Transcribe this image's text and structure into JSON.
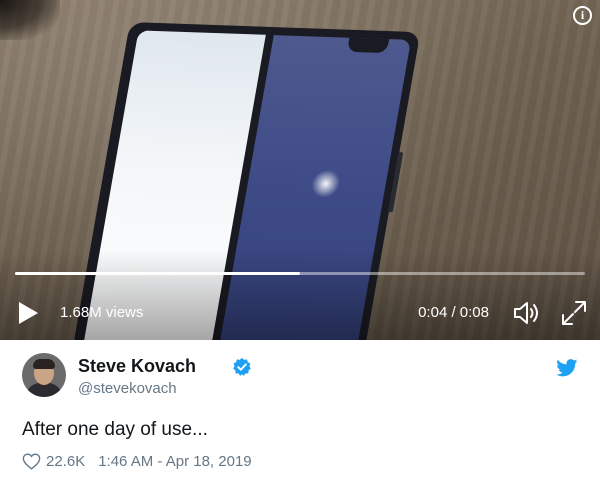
{
  "video": {
    "views": "1.68M views",
    "time": "0:04 / 0:08",
    "progress_fraction": 0.5,
    "info_symbol": "i",
    "icons": [
      "info-icon",
      "play-icon",
      "volume-icon",
      "fullscreen-icon"
    ]
  },
  "author": {
    "name": "Steve Kovach",
    "handle": "@stevekovach",
    "verified": true
  },
  "tweet": {
    "text": "After one day of use..."
  },
  "meta": {
    "likes": "22.6K",
    "timestamp": "1:46 AM - Apr 18, 2019"
  },
  "colors": {
    "twitter_blue": "#1da1f2",
    "text_primary": "#14171a",
    "text_secondary": "#657786"
  }
}
